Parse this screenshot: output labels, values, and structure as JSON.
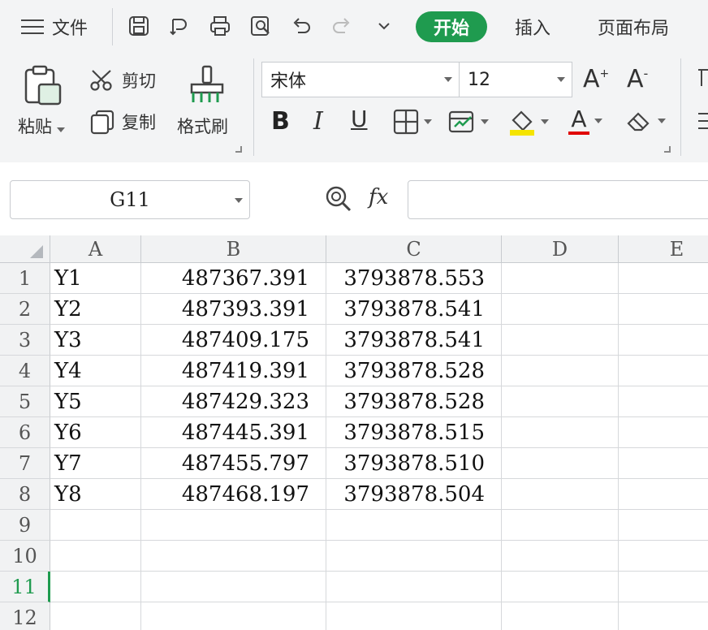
{
  "menu": {
    "label": "文件"
  },
  "tabs": [
    {
      "label": "开始",
      "active": true
    },
    {
      "label": "插入",
      "active": false
    },
    {
      "label": "页面布局",
      "active": false
    }
  ],
  "clipboard": {
    "paste_label": "粘贴",
    "cut_label": "剪切",
    "copy_label": "复制",
    "format_painter_label": "格式刷"
  },
  "font": {
    "name": "宋体",
    "size": "12",
    "increase_label": "A",
    "decrease_label": "A",
    "bold_label": "B",
    "italic_label": "I",
    "underline_label": "U",
    "font_color_label": "A"
  },
  "colors": {
    "accent": "#1f9b4f",
    "highlight_fill": "#f5e400",
    "font_color_bar": "#e00000"
  },
  "formula_bar": {
    "cell_ref": "G11",
    "fx_label": "fx",
    "content": ""
  },
  "sheet": {
    "columns": [
      "A",
      "B",
      "C",
      "D",
      "E"
    ],
    "rows": [
      {
        "num": "1",
        "A": "Y1",
        "B": "487367.391",
        "C": "3793878.553"
      },
      {
        "num": "2",
        "A": "Y2",
        "B": "487393.391",
        "C": "3793878.541"
      },
      {
        "num": "3",
        "A": "Y3",
        "B": "487409.175",
        "C": "3793878.541"
      },
      {
        "num": "4",
        "A": "Y4",
        "B": "487419.391",
        "C": "3793878.528"
      },
      {
        "num": "5",
        "A": "Y5",
        "B": "487429.323",
        "C": "3793878.528"
      },
      {
        "num": "6",
        "A": "Y6",
        "B": "487445.391",
        "C": "3793878.515"
      },
      {
        "num": "7",
        "A": "Y7",
        "B": "487455.797",
        "C": "3793878.510"
      },
      {
        "num": "8",
        "A": "Y8",
        "B": "487468.197",
        "C": "3793878.504"
      },
      {
        "num": "9",
        "A": "",
        "B": "",
        "C": ""
      },
      {
        "num": "10",
        "A": "",
        "B": "",
        "C": ""
      },
      {
        "num": "11",
        "A": "",
        "B": "",
        "C": ""
      },
      {
        "num": "12",
        "A": "",
        "B": "",
        "C": ""
      }
    ],
    "selected_row": "11"
  }
}
